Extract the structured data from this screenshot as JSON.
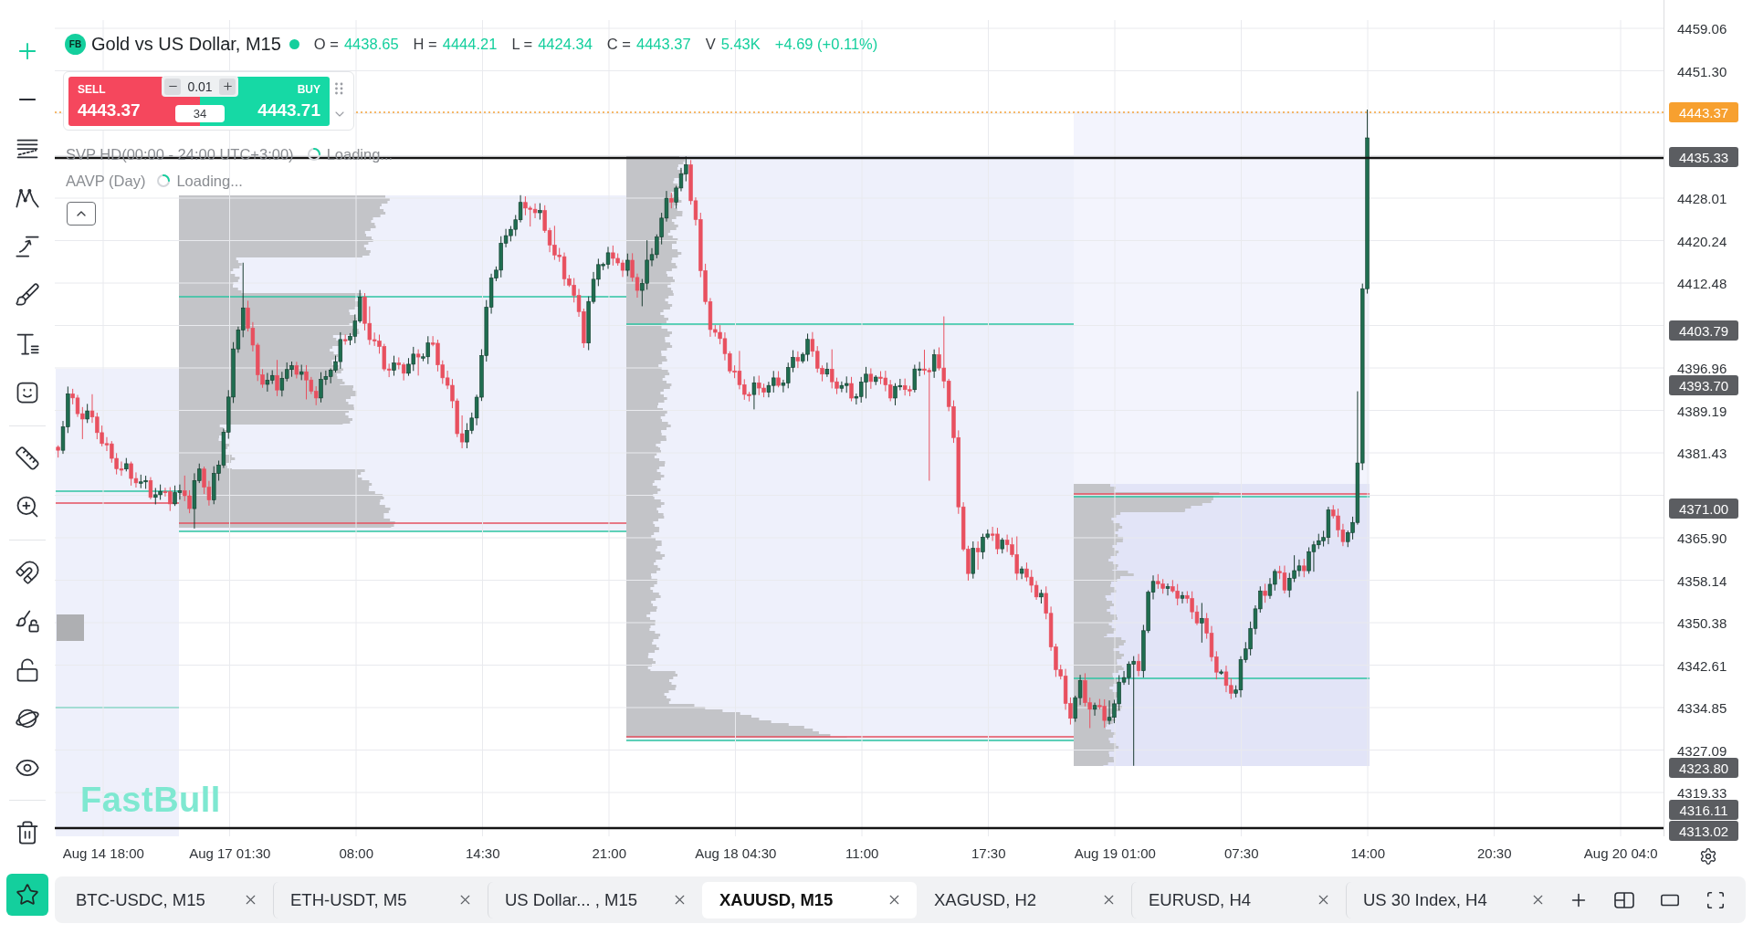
{
  "drawing_toolbar": {
    "groups": [
      {
        "tools": [
          {
            "kind": "crosshair",
            "selected": true
          },
          {
            "kind": "horizontal-line",
            "selected": false
          },
          {
            "kind": "fibonacci",
            "selected": false
          },
          {
            "kind": "pattern",
            "selected": false
          },
          {
            "kind": "trend-arrow",
            "selected": false
          },
          {
            "kind": "brush",
            "selected": false
          },
          {
            "kind": "text",
            "selected": false
          },
          {
            "kind": "emoji",
            "selected": false
          }
        ]
      },
      {
        "tools": [
          {
            "kind": "ruler",
            "selected": false
          },
          {
            "kind": "zoom",
            "selected": false
          }
        ]
      },
      {
        "tools": [
          {
            "kind": "magnet",
            "selected": false
          },
          {
            "kind": "lock-drawings",
            "selected": false
          },
          {
            "kind": "unlock",
            "selected": false
          },
          {
            "kind": "planet",
            "selected": false
          },
          {
            "kind": "eye",
            "selected": false
          }
        ]
      },
      {
        "tools": [
          {
            "kind": "trash",
            "selected": false
          }
        ]
      }
    ]
  },
  "watchlist_button": {
    "selected": true
  },
  "chart": {
    "symbol": {
      "badge": "FB",
      "title": "Gold vs US Dollar, M15",
      "live": true
    },
    "ohlc": [
      {
        "label": "O =",
        "value": "4438.65"
      },
      {
        "label": "H =",
        "value": "4444.21"
      },
      {
        "label": "L =",
        "value": "4424.34"
      },
      {
        "label": "C =",
        "value": "4443.37"
      },
      {
        "label": "V",
        "value": "5.43K"
      }
    ],
    "change": "+4.69 (+0.11%)",
    "trade_panel": {
      "sell_label": "SELL",
      "sell_price": "4443.37",
      "buy_label": "BUY",
      "buy_price": "4443.71",
      "quantity": "0.01",
      "spread": "34"
    },
    "indicators": [
      {
        "name": "SVP HD(00:00 - 24:00 UTC+3:00)",
        "status": "Loading..."
      },
      {
        "name": "AAVP (Day)",
        "status": "Loading..."
      }
    ],
    "logo": "FastBull"
  },
  "price_axis": {
    "ticks": [
      "4459.06",
      "4451.30",
      "4428.01",
      "4420.24",
      "4412.48",
      "4396.96",
      "4389.19",
      "4381.43",
      "4365.90",
      "4358.14",
      "4350.38",
      "4342.61",
      "4334.85",
      "4327.09",
      "4319.33"
    ],
    "tags": [
      {
        "label": "4443.37",
        "kind": "current"
      },
      {
        "label": "4435.33",
        "kind": "level"
      },
      {
        "label": "4403.79",
        "kind": "level"
      },
      {
        "label": "4393.70",
        "kind": "level"
      },
      {
        "label": "4371.00",
        "kind": "level"
      },
      {
        "label": "4323.80",
        "kind": "level"
      },
      {
        "label": "4316.11",
        "kind": "level"
      },
      {
        "label": "4313.02",
        "kind": "level"
      }
    ]
  },
  "time_axis": {
    "ticks": [
      "Aug 14 18:00",
      "Aug 17 01:30",
      "08:00",
      "14:30",
      "21:00",
      "Aug 18 04:30",
      "11:00",
      "17:30",
      "Aug 19 01:00",
      "07:30",
      "14:00",
      "20:30",
      "Aug 20 04:0"
    ]
  },
  "tabs": [
    {
      "label": "BTC-USDC, M15",
      "selected": false
    },
    {
      "label": "ETH-USDT, M5",
      "selected": false
    },
    {
      "label": "US Dollar... , M15",
      "selected": false
    },
    {
      "label": "XAUUSD, M15",
      "selected": true
    },
    {
      "label": "XAGUSD, H2",
      "selected": false
    },
    {
      "label": "EURUSD, H4",
      "selected": false
    },
    {
      "label": "US 30 Index, H4",
      "selected": false
    }
  ]
}
